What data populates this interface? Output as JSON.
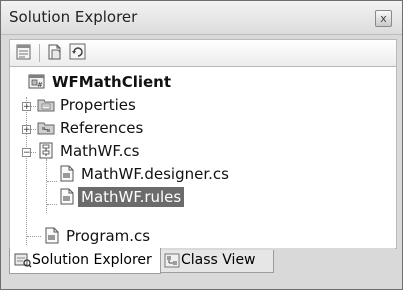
{
  "window": {
    "title": "Solution Explorer",
    "close_label": "x"
  },
  "toolbar": {
    "buttons": [
      {
        "icon": "properties-icon"
      },
      {
        "icon": "show-all-files-icon"
      },
      {
        "icon": "refresh-icon"
      }
    ]
  },
  "tree": {
    "project": {
      "label": "WFMathClient",
      "icon": "csharp-project-icon"
    },
    "items": [
      {
        "label": "Properties",
        "icon": "properties-folder-icon",
        "expander": "+"
      },
      {
        "label": "References",
        "icon": "references-folder-icon",
        "expander": "+"
      },
      {
        "label": "MathWF.cs",
        "icon": "workflow-file-icon",
        "expander": "−"
      },
      {
        "label": "MathWF.designer.cs",
        "icon": "code-file-icon"
      },
      {
        "label": "MathWF.rules",
        "icon": "rules-file-icon",
        "selected": true
      },
      {
        "label": "Program.cs",
        "icon": "code-file-icon"
      }
    ]
  },
  "tabs": [
    {
      "label": "Solution Explorer",
      "active": true,
      "icon": "solution-explorer-icon"
    },
    {
      "label": "Class View",
      "active": false,
      "icon": "class-view-icon"
    }
  ],
  "colors": {
    "selection": "#6b6b6b",
    "chrome": "#d9d9d9"
  }
}
